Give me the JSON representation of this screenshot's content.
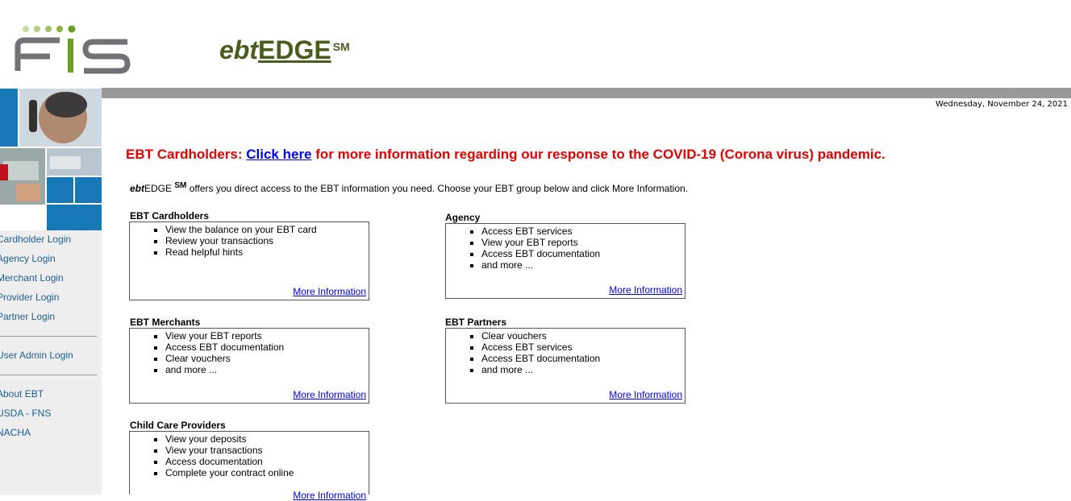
{
  "header": {
    "brand_prefix": "ebt",
    "brand_main": "EDGE",
    "brand_sup": "SM"
  },
  "date": "Wednesday, November 24, 2021",
  "sidebar": {
    "links": [
      "Cardholder Login",
      "Agency Login",
      "Merchant Login",
      "Provider Login",
      "Partner Login"
    ],
    "admin": "User Admin Login",
    "info_links": [
      "About EBT",
      "USDA - FNS",
      "NACHA"
    ]
  },
  "covid": {
    "prefix": "EBT Cardholders: ",
    "link": "Click here",
    "suffix": " for more information regarding our response to the COVID-19 (Corona virus) pandemic."
  },
  "intro": {
    "ebt": "ebt",
    "edge": "EDGE",
    "sup": "SM",
    "text": " offers you direct access to the EBT information you need. Choose your EBT group below and click More Information."
  },
  "groups": {
    "cardholders": {
      "title": "EBT Cardholders",
      "items": [
        "View the balance on your EBT card",
        "Review your transactions",
        "Read helpful hints"
      ],
      "more": "More Information"
    },
    "agency": {
      "title": "Agency",
      "items": [
        "Access EBT services",
        "View your EBT reports",
        "Access EBT documentation",
        "and more ..."
      ],
      "more": "More Information"
    },
    "merchants": {
      "title": "EBT Merchants",
      "items": [
        "View your EBT reports",
        "Access EBT documentation",
        "Clear vouchers",
        "and more ..."
      ],
      "more": "More Information"
    },
    "partners": {
      "title": "EBT Partners",
      "items": [
        "Clear vouchers",
        "Access EBT services",
        "Access EBT documentation",
        "and more ..."
      ],
      "more": "More Information"
    },
    "childcare": {
      "title": "Child Care Providers",
      "items": [
        "View your deposits",
        "View your transactions",
        "Access documentation",
        "Complete your contract online"
      ],
      "more": "More Information"
    }
  },
  "colors": {
    "brand_green": "#4a5d1c",
    "covid_red": "#e00000",
    "link_blue": "#0000ee",
    "nav_blue": "#1a5e91",
    "gray_bar": "#999999",
    "mosaic_blue": "#1877b5"
  }
}
